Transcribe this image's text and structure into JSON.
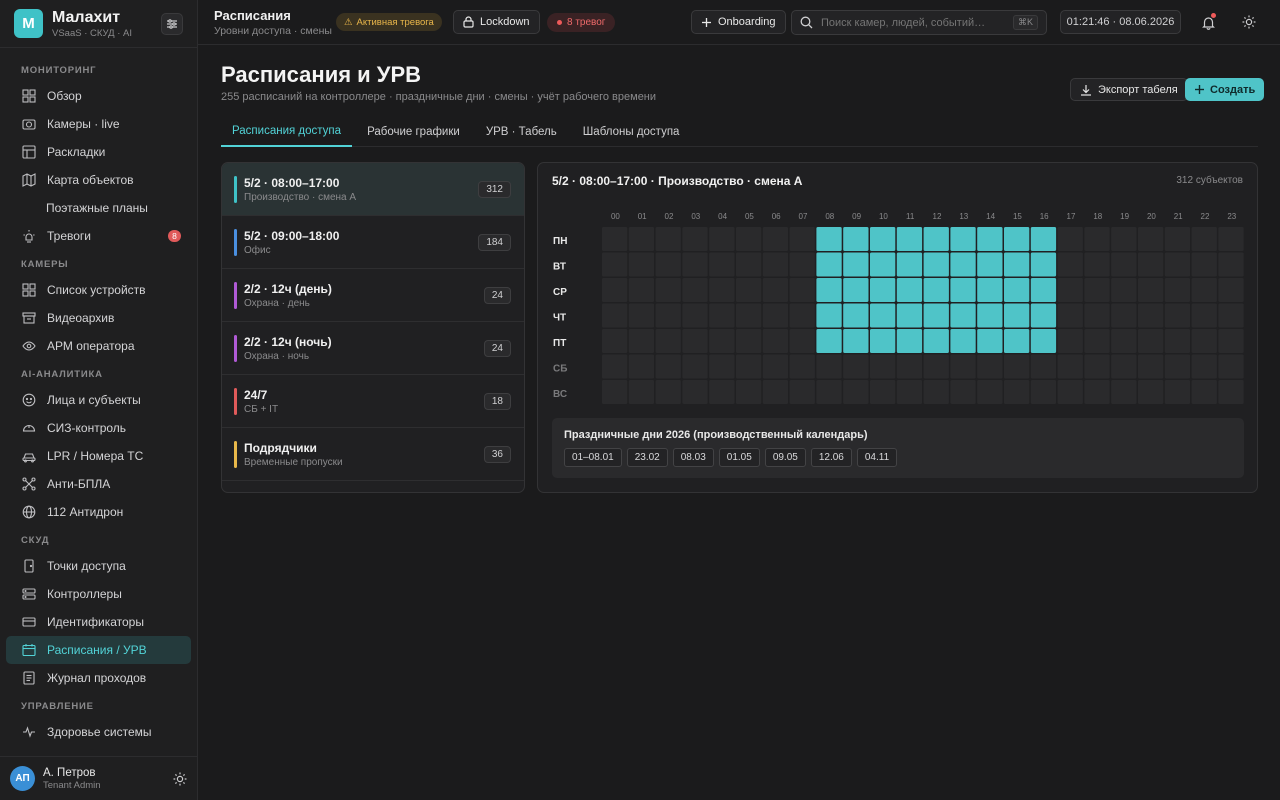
{
  "brand": {
    "logo_letter": "M",
    "name": "Малахит",
    "sub": "VSaaS · СКУД · AI"
  },
  "nav": {
    "sections": [
      {
        "title": "МОНИТОРИНГ",
        "items": [
          {
            "label": "Обзор",
            "icon": "grid-icon"
          },
          {
            "label": "Камеры · live",
            "icon": "camera-icon"
          },
          {
            "label": "Раскладки",
            "icon": "layout-icon"
          },
          {
            "label": "Карта объектов",
            "icon": "map-icon"
          },
          {
            "label": "Поэтажные планы",
            "icon": "",
            "sub": true
          },
          {
            "label": "Тревоги",
            "icon": "bulb-icon",
            "badge": "8"
          }
        ]
      },
      {
        "title": "КАМЕРЫ",
        "items": [
          {
            "label": "Список устройств",
            "icon": "grid-icon"
          },
          {
            "label": "Видеоархив",
            "icon": "archive-icon"
          },
          {
            "label": "АРМ оператора",
            "icon": "eye-icon"
          }
        ]
      },
      {
        "title": "AI-АНАЛИТИКА",
        "items": [
          {
            "label": "Лица и субъекты",
            "icon": "face-icon"
          },
          {
            "label": "СИЗ-контроль",
            "icon": "helmet-icon"
          },
          {
            "label": "LPR / Номера ТС",
            "icon": "car-icon"
          },
          {
            "label": "Анти-БПЛА",
            "icon": "drone-icon"
          },
          {
            "label": "112 Антидрон",
            "icon": "globe-icon"
          }
        ]
      },
      {
        "title": "СКУД",
        "items": [
          {
            "label": "Точки доступа",
            "icon": "door-icon"
          },
          {
            "label": "Контроллеры",
            "icon": "controller-icon"
          },
          {
            "label": "Идентификаторы",
            "icon": "card-icon"
          },
          {
            "label": "Расписания / УРВ",
            "icon": "calendar-icon",
            "active": true
          },
          {
            "label": "Журнал проходов",
            "icon": "journal-icon"
          }
        ]
      },
      {
        "title": "УПРАВЛЕНИЕ",
        "items": [
          {
            "label": "Здоровье системы",
            "icon": "pulse-icon"
          }
        ]
      }
    ]
  },
  "user": {
    "initials": "АП",
    "name": "А. Петров",
    "role": "Tenant Admin"
  },
  "topbar": {
    "title": "Расписания",
    "subtitle": "Уровни доступа · смены",
    "alert_pill": "Активная тревога",
    "lockdown": "Lockdown",
    "alarms": "8 тревог",
    "onboarding": "Onboarding",
    "search_placeholder": "Поиск камер, людей, событий…",
    "search_kbd": "⌘K",
    "clock": "01:21:46 · 08.06.2026"
  },
  "page": {
    "title": "Расписания и УРВ",
    "subtitle": "255 расписаний на контроллере · праздничные дни · смены · учёт рабочего времени",
    "export_label": "Экспорт табеля",
    "create_label": "Создать",
    "tabs": [
      "Расписания доступа",
      "Рабочие графики",
      "УРВ · Табель",
      "Шаблоны доступа"
    ]
  },
  "schedules": [
    {
      "title": "5/2 · 08:00–17:00",
      "sub": "Производство · смена А",
      "count": "312",
      "color": "#3fc2c7",
      "active": true
    },
    {
      "title": "5/2 · 09:00–18:00",
      "sub": "Офис",
      "count": "184",
      "color": "#4a8fe0"
    },
    {
      "title": "2/2 · 12ч (день)",
      "sub": "Охрана · день",
      "count": "24",
      "color": "#b05ad6"
    },
    {
      "title": "2/2 · 12ч (ночь)",
      "sub": "Охрана · ночь",
      "count": "24",
      "color": "#b05ad6"
    },
    {
      "title": "24/7",
      "sub": "СБ + IT",
      "count": "18",
      "color": "#e05a5a"
    },
    {
      "title": "Подрядчики",
      "sub": "Временные пропуски",
      "count": "36",
      "color": "#e8b84a"
    }
  ],
  "detail": {
    "title": "5/2 · 08:00–17:00 · Производство · смена А",
    "count": "312 субъектов",
    "hours": [
      "00",
      "01",
      "02",
      "03",
      "04",
      "05",
      "06",
      "07",
      "08",
      "09",
      "10",
      "11",
      "12",
      "13",
      "14",
      "15",
      "16",
      "17",
      "18",
      "19",
      "20",
      "21",
      "22",
      "23"
    ],
    "days": [
      "ПН",
      "ВТ",
      "СР",
      "ЧТ",
      "ПТ",
      "СБ",
      "ВС"
    ],
    "active_days": [
      "ПН",
      "ВТ",
      "СР",
      "ЧТ",
      "ПТ"
    ],
    "active_hours": [
      "08",
      "09",
      "10",
      "11",
      "12",
      "13",
      "14",
      "15",
      "16"
    ],
    "active_color": "#4fc4c8",
    "holidays_title": "Праздничные дни 2026 (производственный календарь)",
    "holidays": [
      "01–08.01",
      "23.02",
      "08.03",
      "01.05",
      "09.05",
      "12.06",
      "04.11"
    ]
  }
}
